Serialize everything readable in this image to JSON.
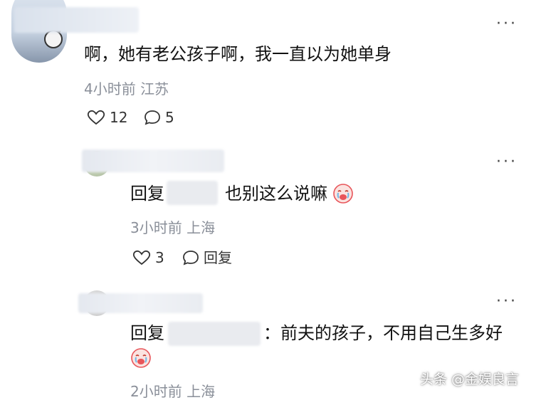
{
  "comments": [
    {
      "content": "啊，她有老公孩子啊，我一直以为她单身",
      "time": "4小时前",
      "location": "江苏",
      "likes": "12",
      "replies": "5",
      "more_icon": "more-horizontal-icon",
      "like_icon": "heart-outline-icon",
      "reply_icon": "speech-bubble-icon"
    },
    {
      "reply_prefix": "回复",
      "content": "也别这么说嘛",
      "emoji": "crying-face-emoji",
      "time": "3小时前",
      "location": "上海",
      "likes": "3",
      "reply_label": "回复",
      "more_icon": "more-horizontal-icon",
      "like_icon": "heart-outline-icon",
      "reply_icon": "speech-bubble-icon"
    },
    {
      "reply_prefix": "回复",
      "content": "：前夫的孩子，不用自己生多好",
      "emoji": "crying-face-emoji",
      "time": "2小时前",
      "location": "上海",
      "more_icon": "more-horizontal-icon"
    }
  ],
  "watermark": "头条 @金娱良言",
  "colors": {
    "text": "#111111",
    "meta": "#8a8f99",
    "emoji": "#e8555a"
  }
}
